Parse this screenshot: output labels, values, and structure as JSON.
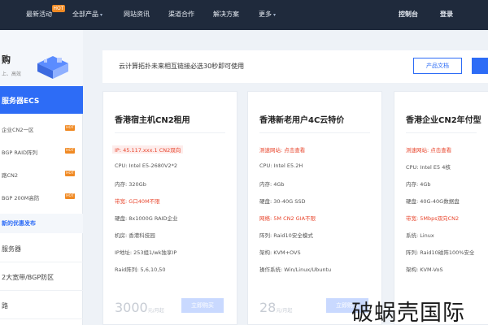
{
  "topnav": {
    "items": [
      {
        "label": "最新活动",
        "badge": "HOT"
      },
      {
        "label": "全部产品"
      },
      {
        "label": "网站资讯"
      },
      {
        "label": "渠道合作"
      },
      {
        "label": "解决方案"
      },
      {
        "label": "更多"
      }
    ],
    "console": "控制台",
    "login": "登录"
  },
  "sidebar": {
    "head_title": "购",
    "head_sub": "上、高效",
    "active": "服务器ECS",
    "items": [
      {
        "label": "企业CN2一区",
        "tag": "HOT"
      },
      {
        "label": "BGP RAID阵列",
        "tag": "HOT"
      },
      {
        "label": "路CN2",
        "tag": "HOT"
      },
      {
        "label": "BGP 200M高防",
        "tag": "HOT"
      }
    ],
    "section": "新的优惠发布",
    "plain": [
      "服务器",
      "2大宽带/BGP防区",
      "路"
    ]
  },
  "notice": {
    "text": "云计算拓扑未来相互链接必选30秒即可使用",
    "doc_button": "产品文档"
  },
  "cards": [
    {
      "title": "香港宿主机CN2租用",
      "specs": [
        {
          "text": "IP: 45.117.xxx.1 CN2双向",
          "style": "red"
        },
        {
          "text": "CPU: Intel E5-2680V2*2",
          "style": ""
        },
        {
          "text": "内存: 320Gb",
          "style": ""
        },
        {
          "text": "带宽: G口40M不限",
          "style": "red"
        },
        {
          "text": "硬盘: 8x1000G RAID企业",
          "style": ""
        },
        {
          "text": "机房: 香港科技园",
          "style": ""
        },
        {
          "text": "IP地址: 253组1/wk独享IP",
          "style": ""
        },
        {
          "text": "Raid阵列: 5,6,10,50",
          "style": ""
        }
      ],
      "price": "3000",
      "unit": "元/月起",
      "buy": "立即购买"
    },
    {
      "title": "香港新老用户4C云特价",
      "specs": [
        {
          "text": "测速网站: 点击查看",
          "style": "red"
        },
        {
          "text": "CPU: Intel E5.2H",
          "style": ""
        },
        {
          "text": "内存: 4Gb",
          "style": ""
        },
        {
          "text": "硬盘: 30-40G SSD",
          "style": ""
        },
        {
          "text": "网络: 5M CN2 GIA不限",
          "style": "red"
        },
        {
          "text": "阵列: Raid10安全模式",
          "style": ""
        },
        {
          "text": "架构: KVM+OVS",
          "style": ""
        },
        {
          "text": "操作系统: Win/Linux/Ubuntu",
          "style": ""
        }
      ],
      "price": "28",
      "unit": "元/月起",
      "buy": "立即购买"
    },
    {
      "title": "香港企业CN2年付型",
      "specs": [
        {
          "text": "测速网站: 点击查看",
          "style": "red"
        },
        {
          "text": "CPU: Intel E5 4核",
          "style": ""
        },
        {
          "text": "内存: 4Gb",
          "style": ""
        },
        {
          "text": "硬盘: 40G-40G数据盘",
          "style": ""
        },
        {
          "text": "带宽: 5Mbps双向CN2",
          "style": "red"
        },
        {
          "text": "系统: Linux",
          "style": ""
        },
        {
          "text": "阵列: Raid10磁阵100%安全",
          "style": ""
        },
        {
          "text": "架构: KVM-VoS",
          "style": ""
        }
      ],
      "price": "",
      "unit": "",
      "buy": ""
    }
  ],
  "watermark": "破蜗壳国际"
}
